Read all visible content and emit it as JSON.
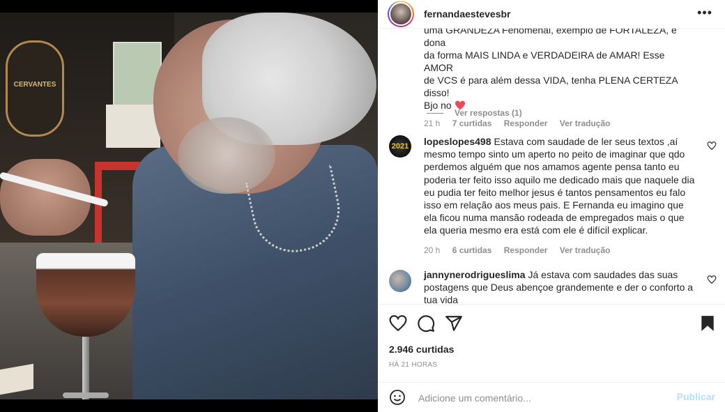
{
  "post": {
    "username": "fernandaestevesbr",
    "more_label": "•••"
  },
  "caption_tail": {
    "line1": "uma GRANDEZA Fenomenal, exemplo de FORTALEZA, é dona",
    "line2": "da forma MAIS LINDA e VERDADEIRA de AMAR! Esse AMOR",
    "line3": "de VCS é para além dessa VIDA, tenha PLENA CERTEZA disso!",
    "line4": "Bjo no",
    "time": "21 h",
    "likes": "7 curtidas",
    "reply": "Responder",
    "translate": "Ver tradução",
    "view_replies": "Ver respostas (1)"
  },
  "comments": [
    {
      "user": "lopeslopes498",
      "text": "Estava com saudade de ler seus textos ,aí mesmo tempo sinto um aperto no peito de imaginar que qdo perdemos alguém que nos amamos agente pensa tanto eu poderia ter feito isso aquilo me dedicado mais que naquele dia eu pudia ter feito melhor jesus é tantos pensamentos eu falo isso em relação aos meus pais. E Fernanda eu imagino que ela ficou numa mansão rodeada de empregados mais o que ela queria mesmo era está com ele é difícil explicar.",
      "time": "20 h",
      "likes": "6 curtidas",
      "reply": "Responder",
      "translate": "Ver tradução"
    },
    {
      "user": "jannynerodrigueslima",
      "text": "Já estava com saudades das suas postagens que Deus abençoe grandemente e der o conforto a tua vida"
    }
  ],
  "actions": {
    "likes": "2.946 curtidas",
    "date": "HÁ 21 HORAS"
  },
  "add_comment": {
    "placeholder": "Adicione um comentário...",
    "post_label": "Publicar"
  },
  "photo": {
    "sign_text": "CERVANTES"
  },
  "colors": {
    "heart_red": "#ed4956",
    "publish_disabled": "#b2dffc",
    "muted": "#8e8e8e"
  },
  "icons": [
    "heart-icon",
    "comment-icon",
    "share-icon",
    "bookmark-icon",
    "emoji-icon",
    "more-icon"
  ]
}
